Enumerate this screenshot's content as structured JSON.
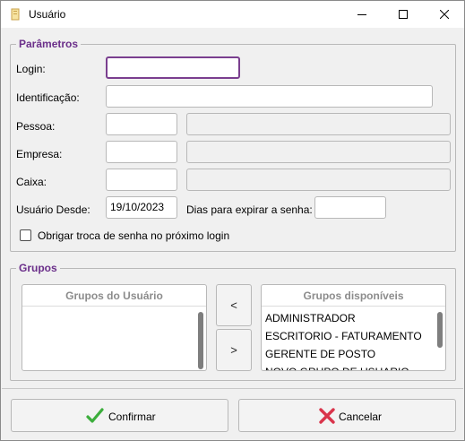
{
  "window": {
    "title": "Usuário"
  },
  "parametros": {
    "legend": "Parâmetros",
    "login": {
      "label": "Login:",
      "value": ""
    },
    "identificacao": {
      "label": "Identificação:",
      "value": ""
    },
    "pessoa": {
      "label": "Pessoa:",
      "code": "",
      "name": ""
    },
    "empresa": {
      "label": "Empresa:",
      "code": "",
      "name": ""
    },
    "caixa": {
      "label": "Caixa:",
      "code": "",
      "name": ""
    },
    "usuario_desde": {
      "label": "Usuário Desde:",
      "value": "19/10/2023"
    },
    "dias_expirar": {
      "label": "Dias para expirar a senha:",
      "value": ""
    },
    "obrigar_troca": {
      "label": "Obrigar troca de senha no próximo login",
      "checked": false
    }
  },
  "grupos": {
    "legend": "Grupos",
    "usuario": {
      "header": "Grupos do Usuário",
      "items": []
    },
    "disponiveis": {
      "header": "Grupos disponíveis",
      "items": [
        "ADMINISTRADOR",
        "ESCRITORIO - FATURAMENTO",
        "GERENTE DE POSTO",
        "NOVO GRUPO DE USUARIO"
      ]
    },
    "add_label": "<",
    "remove_label": ">"
  },
  "actions": {
    "confirm_label": "Confirmar",
    "cancel_label": "Cancelar"
  },
  "colors": {
    "accent": "#6b2f8a",
    "confirm_icon": "#3cae3c",
    "cancel_icon": "#d9344b"
  }
}
